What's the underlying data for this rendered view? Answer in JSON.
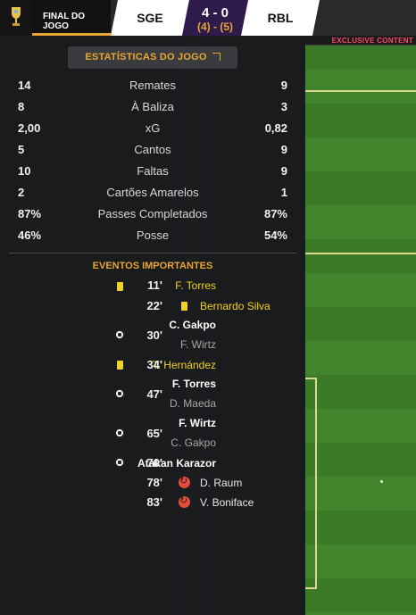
{
  "header": {
    "status": "FINAL DO JOGO",
    "home_team": "SGE",
    "score": "4 - 0",
    "penalties": "(4) - (5)",
    "away_team": "RBL"
  },
  "ad_board_text": "EXCLUSIVE CONTENT",
  "stats": {
    "title": "ESTATÍSTICAS DO JOGO",
    "rows": [
      {
        "home": "14",
        "label": "Remates",
        "away": "9"
      },
      {
        "home": "8",
        "label": "À Baliza",
        "away": "3"
      },
      {
        "home": "2,00",
        "label": "xG",
        "away": "0,82"
      },
      {
        "home": "5",
        "label": "Cantos",
        "away": "9"
      },
      {
        "home": "10",
        "label": "Faltas",
        "away": "9"
      },
      {
        "home": "2",
        "label": "Cartões Amarelos",
        "away": "1"
      },
      {
        "home": "87%",
        "label": "Passes Completados",
        "away": "87%"
      },
      {
        "home": "46%",
        "label": "Posse",
        "away": "54%"
      }
    ]
  },
  "events": {
    "title": "EVENTOS IMPORTANTES",
    "items": [
      {
        "side": "home",
        "type": "yellow-card",
        "player": "F. Torres",
        "minute": "11'"
      },
      {
        "side": "away",
        "type": "yellow-card",
        "player": "Bernardo Silva",
        "minute": "22'"
      },
      {
        "side": "home",
        "type": "goal",
        "player": "C. Gakpo",
        "assist": "F. Wirtz",
        "minute": "30'"
      },
      {
        "side": "home",
        "type": "yellow-card",
        "player": "T. Hernández",
        "minute": "34'"
      },
      {
        "side": "home",
        "type": "goal",
        "player": "F. Torres",
        "assist": "D. Maeda",
        "minute": "47'"
      },
      {
        "side": "home",
        "type": "goal",
        "player": "F. Wirtz",
        "assist": "C. Gakpo",
        "minute": "65'"
      },
      {
        "side": "home",
        "type": "goal",
        "player": "Atakan Karazor",
        "minute": "70'"
      },
      {
        "side": "away",
        "type": "substitution",
        "player": "D. Raum",
        "minute": "78'"
      },
      {
        "side": "away",
        "type": "substitution",
        "player": "V. Boniface",
        "minute": "83'"
      }
    ]
  },
  "colors": {
    "accent": "#e9a633",
    "yellow_card": "#f1d321",
    "score_bg": "#2f1a4c",
    "substitution": "#e74b3c",
    "pitch": "#3c7a27"
  }
}
